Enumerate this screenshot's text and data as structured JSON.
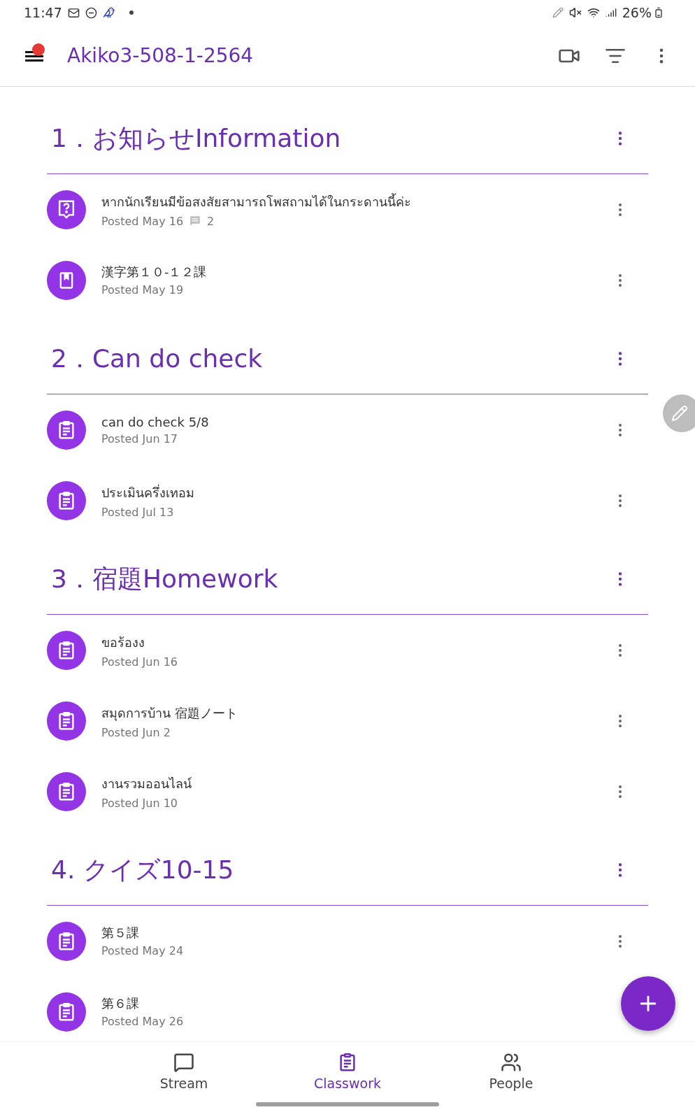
{
  "status_bar": {
    "time": "11:47",
    "battery": "26%"
  },
  "app_bar": {
    "title": "Akiko3-508-1-2564"
  },
  "sections": [
    {
      "title": "1．お知らせInformation",
      "items": [
        {
          "kind": "question",
          "title": "หากนักเรียนมีข้อสงสัยสามารถโพสถามได้ในกระดานนี้ค่ะ",
          "posted": "Posted May 16",
          "comments": "2"
        },
        {
          "kind": "material",
          "title": "漢字第１０-１２課",
          "posted": "Posted May 19"
        }
      ]
    },
    {
      "title": "2．Can do check",
      "items": [
        {
          "kind": "assignment",
          "title": "can do check 5/8",
          "posted": "Posted Jun 17"
        },
        {
          "kind": "assignment",
          "title": "ประเมินครึ่งเทอม",
          "posted": "Posted Jul 13"
        }
      ]
    },
    {
      "title": "3．宿題Homework",
      "items": [
        {
          "kind": "assignment",
          "title": "ขอร้องง",
          "posted": "Posted Jun 16"
        },
        {
          "kind": "assignment",
          "title": "สมุดการบ้าน 宿題ノート",
          "posted": "Posted Jun 2"
        },
        {
          "kind": "assignment",
          "title": "งานรวมออนไลน์",
          "posted": "Posted Jun 10"
        }
      ]
    },
    {
      "title": "4. クイズ10-15",
      "items": [
        {
          "kind": "assignment",
          "title": "第５課",
          "posted": "Posted May 24"
        },
        {
          "kind": "assignment",
          "title": "第６課",
          "posted": "Posted May 26"
        }
      ]
    }
  ],
  "bottom_nav": [
    {
      "kind": "stream",
      "label": "Stream",
      "selected": false
    },
    {
      "kind": "classwork",
      "label": "Classwork",
      "selected": true
    },
    {
      "kind": "people",
      "label": "People",
      "selected": false
    }
  ]
}
